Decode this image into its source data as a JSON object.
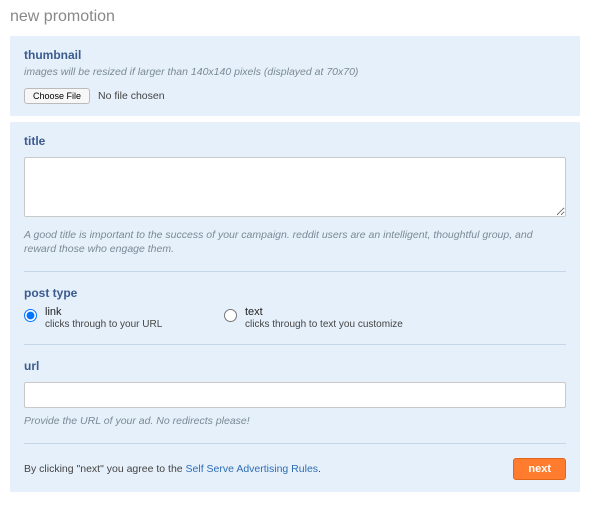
{
  "page": {
    "title": "new promotion"
  },
  "thumbnail": {
    "heading": "thumbnail",
    "hint": "images will be resized if larger than 140x140 pixels (displayed at 70x70)",
    "choose_label": "Choose File",
    "no_file": "No file chosen"
  },
  "title_section": {
    "heading": "title",
    "value": "",
    "hint": "A good title is important to the success of your campaign. reddit users are an intelligent, thoughtful group, and reward those who engage them."
  },
  "post_type": {
    "heading": "post type",
    "options": [
      {
        "label": "link",
        "sub": "clicks through to your URL",
        "checked": true
      },
      {
        "label": "text",
        "sub": "clicks through to text you customize",
        "checked": false
      }
    ]
  },
  "url_section": {
    "heading": "url",
    "value": "",
    "hint": "Provide the URL of your ad. No redirects please!"
  },
  "footer": {
    "agree_prefix": "By clicking \"next\" you agree to the ",
    "rules_link": "Self Serve Advertising Rules",
    "agree_suffix": ".",
    "next_label": "next"
  }
}
